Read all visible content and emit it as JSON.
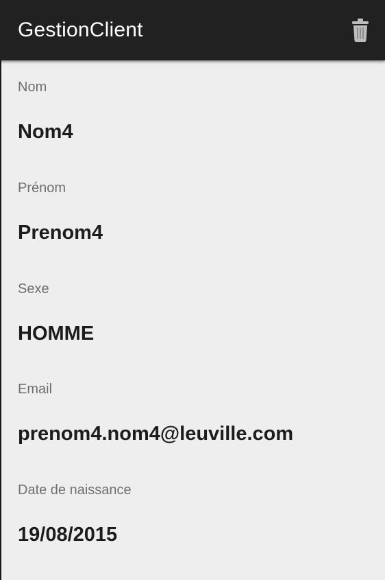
{
  "app_bar": {
    "title": "GestionClient",
    "action_icon": "trash-icon"
  },
  "fields": [
    {
      "label": "Nom",
      "value": "Nom4"
    },
    {
      "label": "Prénom",
      "value": "Prenom4"
    },
    {
      "label": "Sexe",
      "value": "HOMME"
    },
    {
      "label": "Email",
      "value": "prenom4.nom4@leuville.com"
    },
    {
      "label": "Date de naissance",
      "value": "19/08/2015"
    }
  ],
  "colors": {
    "app_bar_background": "#212121",
    "content_background": "#eeeeee",
    "label_text": "#6f6f6f",
    "value_text": "#1c1c1c"
  }
}
